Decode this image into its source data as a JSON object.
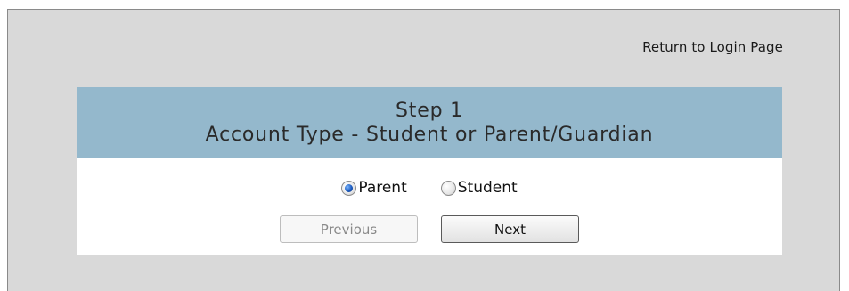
{
  "header": {
    "return_link": "Return to Login Page"
  },
  "step": {
    "title": "Step 1",
    "subtitle": "Account Type - Student or Parent/Guardian"
  },
  "account_type": {
    "selected": "Parent",
    "options": [
      {
        "label": "Parent",
        "checked": true
      },
      {
        "label": "Student",
        "checked": false
      }
    ]
  },
  "buttons": {
    "previous_label": "Previous",
    "next_label": "Next",
    "previous_disabled": true
  },
  "colors": {
    "page_background": "#d9d9d9",
    "header_background": "#94b8cc",
    "panel_background": "#ffffff"
  }
}
